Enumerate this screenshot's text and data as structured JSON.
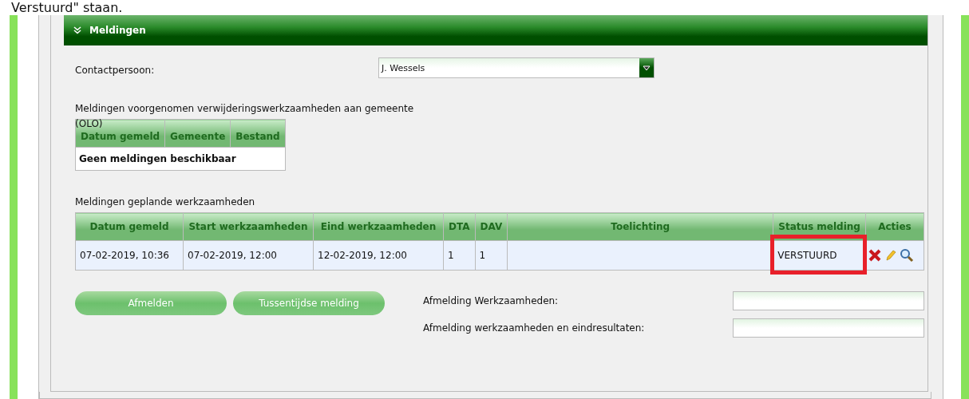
{
  "caption": "Verstuurd\" staan.",
  "panel": {
    "title": "Meldingen",
    "expanded": true
  },
  "contact": {
    "label": "Contactpersoon:",
    "value": "J. Wessels"
  },
  "olo_table": {
    "title": "Meldingen voorgenomen verwijderingswerkzaamheden aan gemeente",
    "title_overflow": "(OLO)",
    "columns": [
      "Datum gemeld",
      "Gemeente",
      "Bestand"
    ],
    "empty_message": "Geen meldingen beschikbaar"
  },
  "planned_table": {
    "title": "Meldingen geplande werkzaamheden",
    "columns": [
      "Datum gemeld",
      "Start werkzaamheden",
      "Eind werkzaamheden",
      "DTA",
      "DAV",
      "Toelichting",
      "Status melding",
      "Acties"
    ],
    "rows": [
      {
        "cells": [
          "07-02-2019, 10:36",
          "07-02-2019, 12:00",
          "12-02-2019, 12:00",
          "1",
          "1",
          ""
        ],
        "status": "VERSTUURD",
        "status_highlighted": true
      }
    ]
  },
  "buttons": [
    "Afmelden",
    "Tussentijdse melding"
  ],
  "fields": [
    {
      "label": "Afmelding Werkzaamheden:"
    },
    {
      "label": "Afmelding werkzaamheden en eindresultaten:"
    }
  ]
}
